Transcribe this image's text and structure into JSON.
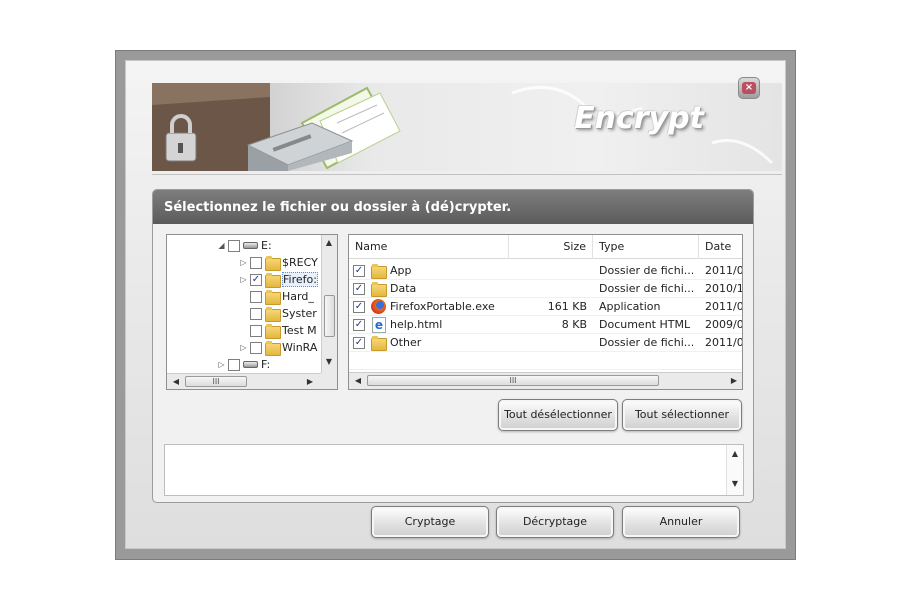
{
  "window": {
    "banner_title": "Encrypt",
    "close_glyph": "×"
  },
  "panel": {
    "heading": "Sélectionnez le fichier ou dossier à (dé)crypter."
  },
  "tree": {
    "items": [
      {
        "label": "E:",
        "kind": "drive",
        "checked": false,
        "expander": "◢"
      },
      {
        "label": "$RECY",
        "kind": "folder",
        "checked": false,
        "expander": "▷"
      },
      {
        "label": "Firefo:",
        "kind": "folder",
        "checked": true,
        "expander": "▷"
      },
      {
        "label": "Hard_",
        "kind": "folder",
        "checked": false,
        "expander": ""
      },
      {
        "label": "Syster",
        "kind": "folder",
        "checked": false,
        "expander": ""
      },
      {
        "label": "Test M",
        "kind": "folder",
        "checked": false,
        "expander": ""
      },
      {
        "label": "WinRA",
        "kind": "folder",
        "checked": false,
        "expander": "▷"
      },
      {
        "label": "F:",
        "kind": "drive",
        "checked": false,
        "expander": "▷"
      }
    ]
  },
  "file_list": {
    "columns": [
      "Name",
      "Size",
      "Type",
      "Date"
    ],
    "rows": [
      {
        "name": "App",
        "size": "",
        "type": "Dossier de fichi...",
        "date": "2011/0",
        "icon": "folder-icon",
        "checked": true
      },
      {
        "name": "Data",
        "size": "",
        "type": "Dossier de fichi...",
        "date": "2010/1",
        "icon": "folder-icon",
        "checked": true
      },
      {
        "name": "FirefoxPortable.exe",
        "size": "161 KB",
        "type": "Application",
        "date": "2011/0",
        "icon": "firefox-icon",
        "checked": true
      },
      {
        "name": "help.html",
        "size": "8 KB",
        "type": "Document HTML",
        "date": "2009/0",
        "icon": "html-document-icon",
        "checked": true
      },
      {
        "name": "Other",
        "size": "",
        "type": "Dossier de fichi...",
        "date": "2011/0",
        "icon": "folder-icon",
        "checked": true
      }
    ]
  },
  "buttons": {
    "deselect_all": "Tout désélectionner",
    "select_all": "Tout sélectionner",
    "encrypt": "Cryptage",
    "decrypt": "Décryptage",
    "cancel": "Annuler"
  },
  "scroll_glyphs": {
    "up": "▲",
    "down": "▼",
    "left": "◀",
    "right": "▶",
    "grip": "III"
  },
  "checkmark": "✓",
  "colors": {
    "header_bg": "#6b6b6b",
    "window_frame": "#9a9a9a",
    "folder_yellow": "#e9bf4b"
  }
}
